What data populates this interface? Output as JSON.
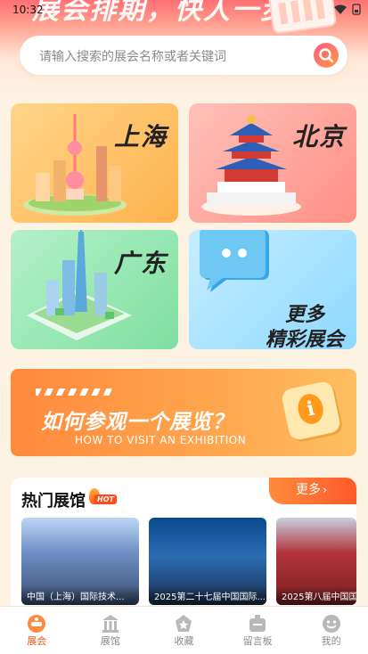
{
  "status_bar": {
    "time": "10:32"
  },
  "banner": {
    "slogan": "展会排期，快人一步"
  },
  "search": {
    "placeholder": "请输入搜索的展会名称或者关键词"
  },
  "city_cards": {
    "shanghai": "上海",
    "beijing": "北京",
    "guangdong": "广东",
    "more_line1": "更多",
    "more_line2": "精彩展会"
  },
  "visit_banner": {
    "title": "如何参观一个展览？",
    "subtitle": "HOW TO VISIT AN EXHIBITION"
  },
  "hot": {
    "title": "热门展馆",
    "badge": "HOT",
    "more_label": "更多",
    "items": [
      {
        "caption": "中国（上海）国际技术..."
      },
      {
        "caption": "2025第二十七届中国国际..."
      },
      {
        "caption": "2025第八届中国国"
      }
    ]
  },
  "bottom_nav": [
    {
      "label": "展会",
      "icon": "exhibition-icon",
      "active": true
    },
    {
      "label": "展馆",
      "icon": "venue-icon",
      "active": false
    },
    {
      "label": "收藏",
      "icon": "favorite-icon",
      "active": false
    },
    {
      "label": "留言板",
      "icon": "message-board-icon",
      "active": false
    },
    {
      "label": "我的",
      "icon": "profile-icon",
      "active": false
    }
  ],
  "colors": {
    "accent": "#ff8a3d",
    "active_nav": "#e85a12",
    "background": "#fdf3e3"
  }
}
